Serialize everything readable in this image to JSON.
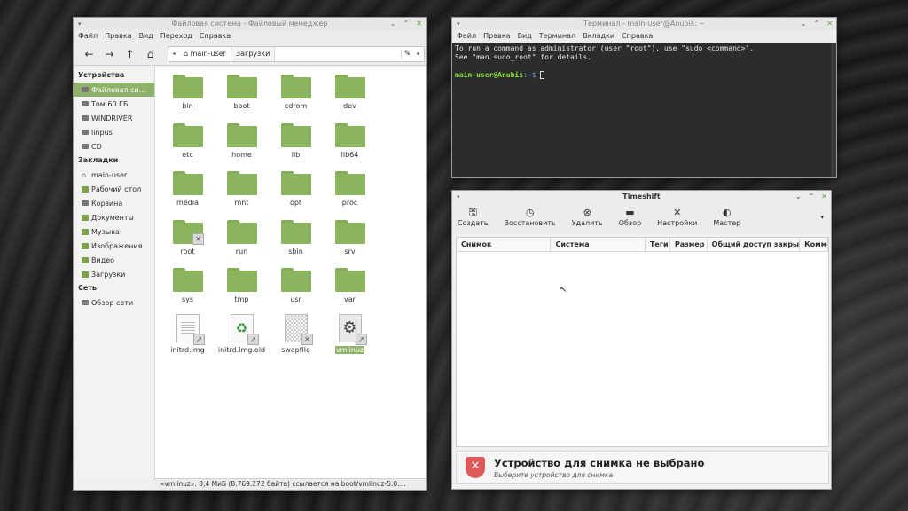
{
  "file_manager": {
    "title": "Файловая система - Файловый менеджер",
    "menu": [
      "Файл",
      "Правка",
      "Вид",
      "Переход",
      "Справка"
    ],
    "toolbar": {
      "back": "←",
      "forward": "→",
      "up": "↑",
      "home": "⌂"
    },
    "path": [
      "main-user",
      "Загрузки"
    ],
    "sidebar": {
      "devices_header": "Устройства",
      "devices": [
        {
          "label": "Файловая си...",
          "icon": "drive-icon",
          "selected": true
        },
        {
          "label": "Том 60 ГБ",
          "icon": "drive-icon"
        },
        {
          "label": "WINDRIVER",
          "icon": "drive-icon"
        },
        {
          "label": "linpus",
          "icon": "drive-icon"
        },
        {
          "label": "CD",
          "icon": "optical-drive-icon"
        }
      ],
      "bookmarks_header": "Закладки",
      "bookmarks": [
        {
          "label": "main-user",
          "icon": "home-icon"
        },
        {
          "label": "Рабочий стол",
          "icon": "folder-icon"
        },
        {
          "label": "Корзина",
          "icon": "trash-icon"
        },
        {
          "label": "Документы",
          "icon": "folder-icon"
        },
        {
          "label": "Музыка",
          "icon": "folder-icon"
        },
        {
          "label": "Изображения",
          "icon": "folder-icon"
        },
        {
          "label": "Видео",
          "icon": "folder-icon"
        },
        {
          "label": "Загрузки",
          "icon": "folder-icon"
        }
      ],
      "network_header": "Сеть",
      "network": [
        {
          "label": "Обзор сети",
          "icon": "network-icon"
        }
      ]
    },
    "items": [
      {
        "name": "bin",
        "type": "folder"
      },
      {
        "name": "boot",
        "type": "folder"
      },
      {
        "name": "cdrom",
        "type": "folder"
      },
      {
        "name": "dev",
        "type": "folder"
      },
      {
        "name": "etc",
        "type": "folder"
      },
      {
        "name": "home",
        "type": "folder"
      },
      {
        "name": "lib",
        "type": "folder"
      },
      {
        "name": "lib64",
        "type": "folder"
      },
      {
        "name": "media",
        "type": "folder"
      },
      {
        "name": "mnt",
        "type": "folder"
      },
      {
        "name": "opt",
        "type": "folder"
      },
      {
        "name": "proc",
        "type": "folder"
      },
      {
        "name": "root",
        "type": "folder",
        "badge": "locked"
      },
      {
        "name": "run",
        "type": "folder"
      },
      {
        "name": "sbin",
        "type": "folder"
      },
      {
        "name": "srv",
        "type": "folder"
      },
      {
        "name": "sys",
        "type": "folder"
      },
      {
        "name": "tmp",
        "type": "folder"
      },
      {
        "name": "usr",
        "type": "folder"
      },
      {
        "name": "var",
        "type": "folder"
      },
      {
        "name": "initrd.img",
        "type": "file-text",
        "badge": "link"
      },
      {
        "name": "initrd.img.old",
        "type": "file-recycle",
        "badge": "link"
      },
      {
        "name": "swapfile",
        "type": "file-checker",
        "badge": "locked"
      },
      {
        "name": "vmlinuz",
        "type": "file-gear",
        "badge": "link",
        "selected": true
      }
    ],
    "status": "«vmlinuz»: 8,4 МиБ (8.769.272 байта) ссылается на boot/vmlinuz-5.0...."
  },
  "terminal": {
    "title": "Терминал - main-user@Anubis: ~",
    "menu": [
      "Файл",
      "Правка",
      "Вид",
      "Терминал",
      "Вкладки",
      "Справка"
    ],
    "lines": [
      "To run a command as administrator (user \"root\"), use \"sudo <command>\".",
      "See \"man sudo_root\" for details."
    ],
    "prompt_user": "main-user@Anubis",
    "prompt_path": ":~$"
  },
  "timeshift": {
    "title": "Timeshift",
    "buttons": [
      {
        "label": "Создать",
        "icon": "save-icon",
        "glyph": "🖫"
      },
      {
        "label": "Восстановить",
        "icon": "clock-icon",
        "glyph": "◷"
      },
      {
        "label": "Удалить",
        "icon": "delete-icon",
        "glyph": "⊗"
      },
      {
        "label": "Обзор",
        "icon": "folder-icon",
        "glyph": "▬"
      },
      {
        "label": "Настройки",
        "icon": "tools-icon",
        "glyph": "✕"
      },
      {
        "label": "Мастер",
        "icon": "wizard-icon",
        "glyph": "◐"
      }
    ],
    "columns": [
      "Снимок",
      "Система",
      "Теги",
      "Размер",
      "Общий доступ закрыт",
      "Комме"
    ],
    "info_title": "Устройство для снимка не выбрано",
    "info_subtitle": "Выберите устройство для снимка"
  }
}
